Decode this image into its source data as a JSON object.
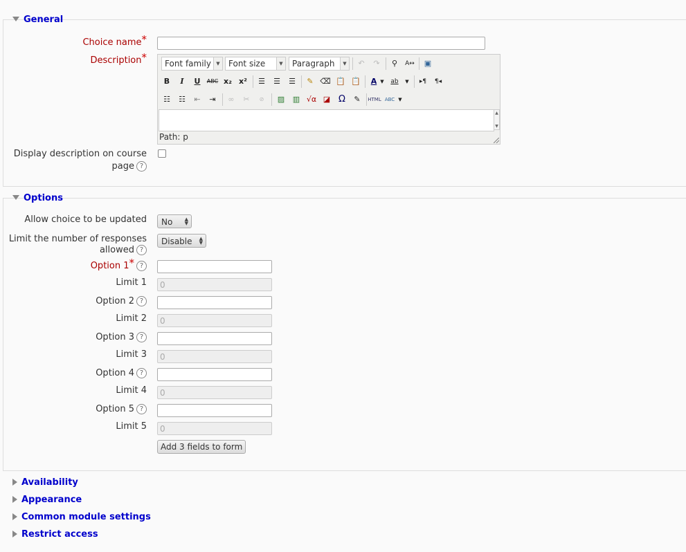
{
  "sections": {
    "general": "General",
    "options": "Options",
    "collapsed": [
      "Availability",
      "Appearance",
      "Common module settings",
      "Restrict access"
    ]
  },
  "general": {
    "choice_name_label": "Choice name",
    "description_label": "Description",
    "display_desc_label_line1": "Display description on course",
    "display_desc_label_line2": "page",
    "required_mark": "*",
    "help_mark": "?"
  },
  "editor": {
    "font_family": "Font family",
    "font_size": "Font size",
    "format": "Paragraph",
    "path_label": "Path: p",
    "buttons": {
      "bold": "B",
      "italic": "I",
      "underline": "U",
      "strike": "ABC",
      "subscript": "x₂",
      "superscript": "x²",
      "omega": "Ω",
      "html": "HTML",
      "spell": "ABC",
      "font_color": "A",
      "highlight": "ab",
      "ltr": "▸¶",
      "rtl": "¶◂"
    }
  },
  "options": {
    "allow_update_label": "Allow choice to be updated",
    "allow_update_value": "No",
    "limit_label_line1": "Limit the number of responses",
    "limit_label_line2": "allowed",
    "limit_value": "Disable",
    "items": [
      {
        "option_label": "Option 1",
        "limit_label": "Limit 1",
        "limit_value": "0"
      },
      {
        "option_label": "Option 2",
        "limit_label": "Limit 2",
        "limit_value": "0"
      },
      {
        "option_label": "Option 3",
        "limit_label": "Limit 3",
        "limit_value": "0"
      },
      {
        "option_label": "Option 4",
        "limit_label": "Limit 4",
        "limit_value": "0"
      },
      {
        "option_label": "Option 5",
        "limit_label": "Limit 5",
        "limit_value": "0"
      }
    ],
    "add_fields_button": "Add 3 fields to form"
  },
  "colors": {
    "link": "#0000cc",
    "required": "#aa0000",
    "border": "#dddddd"
  }
}
